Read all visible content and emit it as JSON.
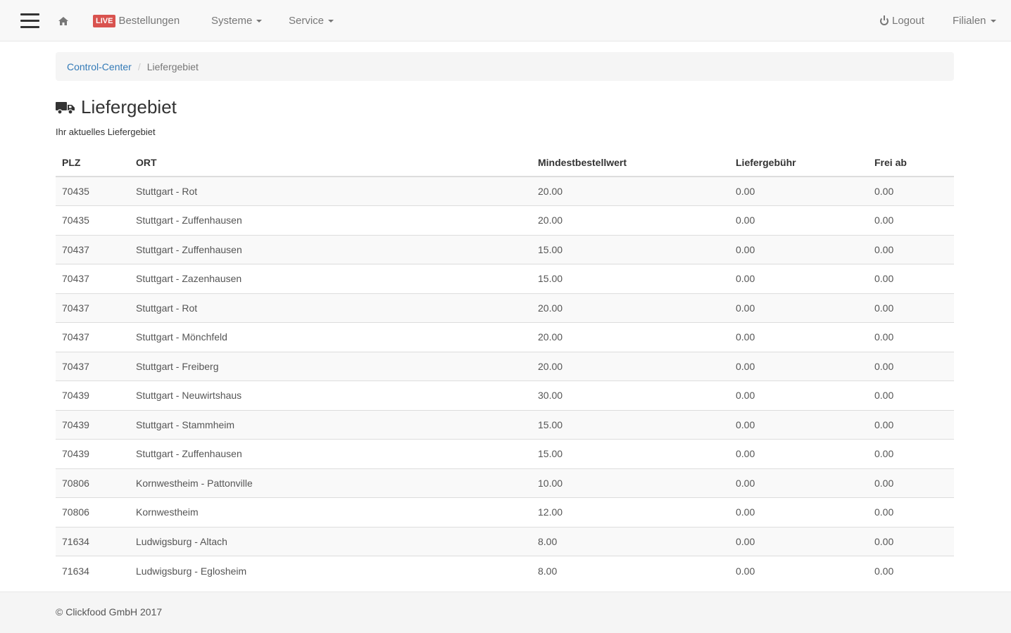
{
  "navbar": {
    "menu_icon": "hamburger-icon",
    "home_icon": "home-icon",
    "live_badge": "LIVE",
    "orders_label": "Bestellungen",
    "systeme_label": "Systeme",
    "service_label": "Service",
    "logout_label": "Logout",
    "logout_icon": "power-icon",
    "filialen_label": "Filialen"
  },
  "breadcrumb": {
    "home": "Control-Center",
    "separator": "/",
    "current": "Liefergebiet"
  },
  "page": {
    "title": "Liefergebiet",
    "title_icon": "truck-icon",
    "subtitle": "Ihr aktuelles Liefergebiet"
  },
  "table": {
    "headers": [
      "PLZ",
      "ORT",
      "Mindestbestellwert",
      "Liefergebühr",
      "Frei ab"
    ],
    "rows": [
      [
        "70435",
        "Stuttgart - Rot",
        "20.00",
        "0.00",
        "0.00"
      ],
      [
        "70435",
        "Stuttgart - Zuffenhausen",
        "20.00",
        "0.00",
        "0.00"
      ],
      [
        "70437",
        "Stuttgart - Zuffenhausen",
        "15.00",
        "0.00",
        "0.00"
      ],
      [
        "70437",
        "Stuttgart - Zazenhausen",
        "15.00",
        "0.00",
        "0.00"
      ],
      [
        "70437",
        "Stuttgart - Rot",
        "20.00",
        "0.00",
        "0.00"
      ],
      [
        "70437",
        "Stuttgart - Mönchfeld",
        "20.00",
        "0.00",
        "0.00"
      ],
      [
        "70437",
        "Stuttgart - Freiberg",
        "20.00",
        "0.00",
        "0.00"
      ],
      [
        "70439",
        "Stuttgart - Neuwirtshaus",
        "30.00",
        "0.00",
        "0.00"
      ],
      [
        "70439",
        "Stuttgart - Stammheim",
        "15.00",
        "0.00",
        "0.00"
      ],
      [
        "70439",
        "Stuttgart - Zuffenhausen",
        "15.00",
        "0.00",
        "0.00"
      ],
      [
        "70806",
        "Kornwestheim - Pattonville",
        "10.00",
        "0.00",
        "0.00"
      ],
      [
        "70806",
        "Kornwestheim",
        "12.00",
        "0.00",
        "0.00"
      ],
      [
        "71634",
        "Ludwigsburg - Altach",
        "8.00",
        "0.00",
        "0.00"
      ],
      [
        "71634",
        "Ludwigsburg - Eglosheim",
        "8.00",
        "0.00",
        "0.00"
      ]
    ]
  },
  "footer": {
    "copyright": "© Clickfood GmbH 2017"
  },
  "colors": {
    "live_badge": "#d9534f",
    "link": "#337ab7",
    "navbar_bg": "#f8f8f8"
  }
}
